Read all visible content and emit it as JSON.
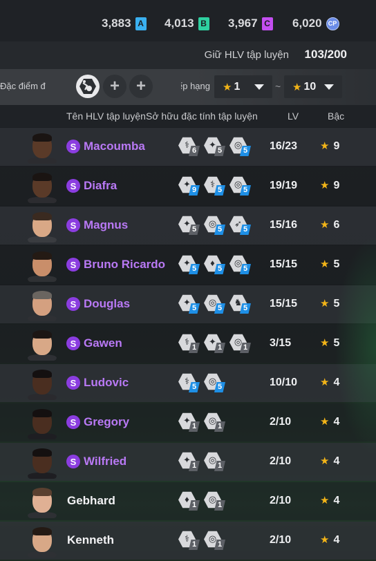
{
  "currencies": [
    {
      "value": "3,883",
      "badge": "A",
      "color": "#3ab0f0"
    },
    {
      "value": "4,013",
      "badge": "B",
      "color": "#2ed0a0"
    },
    {
      "value": "3,967",
      "badge": "C",
      "color": "#c34ef0"
    },
    {
      "value": "6,020",
      "badge": "CP",
      "color": "#6a8ce8"
    }
  ],
  "hold": {
    "label": "Giữ HLV tập luyện",
    "count": "103/200"
  },
  "filters": {
    "trait_label": "Đặc điểm đ",
    "rank_label": "Xếp hạng",
    "min_grade": "1",
    "max_grade": "10",
    "separator": "~",
    "add_symbol": "+"
  },
  "columns": {
    "name": "Tên HLV tập luyện",
    "traits": "Sở hữu đặc tính tập luyện",
    "level": "LV",
    "grade": "Bậc"
  },
  "special_badge": "S",
  "star_glyph": "★",
  "trainers": [
    {
      "name": "Macoumba",
      "special": true,
      "lv": "16/23",
      "grade": "9",
      "skin": "#5a3a28",
      "hair": "#1a1412",
      "shirt": "#2c2c30",
      "traits": [
        {
          "icon": "shield-icon",
          "glyph": "⚕",
          "level": "6",
          "tier": "gray"
        },
        {
          "icon": "kick-icon",
          "glyph": "✦",
          "level": "5",
          "tier": "gray"
        },
        {
          "icon": "dribble-icon",
          "glyph": "◎",
          "level": "5",
          "tier": "blue"
        }
      ]
    },
    {
      "name": "Diafra",
      "special": true,
      "lv": "19/19",
      "grade": "9",
      "skin": "#5a3a28",
      "hair": "#1a1412",
      "shirt": "#2c2c30",
      "traits": [
        {
          "icon": "kick-icon",
          "glyph": "✦",
          "level": "9",
          "tier": "blue"
        },
        {
          "icon": "shield-icon",
          "glyph": "⚕",
          "level": "5",
          "tier": "blue"
        },
        {
          "icon": "dribble-icon",
          "glyph": "◎",
          "level": "5",
          "tier": "blue"
        }
      ]
    },
    {
      "name": "Magnus",
      "special": true,
      "lv": "15/16",
      "grade": "6",
      "skin": "#d9a886",
      "hair": "#3a2a20",
      "shirt": "#3a3c40",
      "traits": [
        {
          "icon": "kick-icon",
          "glyph": "✦",
          "level": "5",
          "tier": "gray"
        },
        {
          "icon": "dribble-icon",
          "glyph": "◎",
          "level": "5",
          "tier": "blue"
        },
        {
          "icon": "tackle-icon",
          "glyph": "➶",
          "level": "5",
          "tier": "blue"
        }
      ]
    },
    {
      "name": "Bruno Ricardo",
      "special": true,
      "lv": "15/15",
      "grade": "5",
      "skin": "#c98e6a",
      "hair": "#241a14",
      "shirt": "#2f3134",
      "traits": [
        {
          "icon": "kick-icon",
          "glyph": "✦",
          "level": "5",
          "tier": "blue"
        },
        {
          "icon": "bottle-icon",
          "glyph": "♦",
          "level": "5",
          "tier": "blue"
        },
        {
          "icon": "dribble-icon",
          "glyph": "◎",
          "level": "5",
          "tier": "blue"
        }
      ]
    },
    {
      "name": "Douglas",
      "special": true,
      "lv": "15/15",
      "grade": "5",
      "skin": "#d4a080",
      "hair": "#6a6560",
      "shirt": "#2e3034",
      "traits": [
        {
          "icon": "kick-icon",
          "glyph": "✦",
          "level": "5",
          "tier": "blue"
        },
        {
          "icon": "dribble-icon",
          "glyph": "◎",
          "level": "5",
          "tier": "blue"
        },
        {
          "icon": "keeper-icon",
          "glyph": "♞",
          "level": "5",
          "tier": "blue"
        }
      ]
    },
    {
      "name": "Gawen",
      "special": true,
      "lv": "3/15",
      "grade": "5",
      "skin": "#d8a887",
      "hair": "#1c1614",
      "shirt": "#2e3034",
      "traits": [
        {
          "icon": "shield-icon",
          "glyph": "⚕",
          "level": "1",
          "tier": "gray"
        },
        {
          "icon": "kick-icon",
          "glyph": "✦",
          "level": "1",
          "tier": "gray"
        },
        {
          "icon": "dribble-icon",
          "glyph": "◎",
          "level": "1",
          "tier": "gray"
        }
      ]
    },
    {
      "name": "Ludovic",
      "special": true,
      "lv": "10/10",
      "grade": "4",
      "skin": "#4a2e20",
      "hair": "#141010",
      "shirt": "#2a2a2e",
      "traits": [
        {
          "icon": "shield-icon",
          "glyph": "⚕",
          "level": "5",
          "tier": "blue"
        },
        {
          "icon": "dribble-icon",
          "glyph": "◎",
          "level": "5",
          "tier": "blue"
        }
      ]
    },
    {
      "name": "Gregory",
      "special": true,
      "lv": "2/10",
      "grade": "4",
      "skin": "#4a2e20",
      "hair": "#141010",
      "shirt": "#1e1e22",
      "traits": [
        {
          "icon": "kick-icon",
          "glyph": "✦",
          "level": "1",
          "tier": "gray"
        },
        {
          "icon": "dribble-icon",
          "glyph": "◎",
          "level": "1",
          "tier": "gray"
        }
      ]
    },
    {
      "name": "Wilfried",
      "special": true,
      "lv": "2/10",
      "grade": "4",
      "skin": "#4a2e20",
      "hair": "#141010",
      "shirt": "#1e1e22",
      "traits": [
        {
          "icon": "kick-icon",
          "glyph": "✦",
          "level": "1",
          "tier": "gray"
        },
        {
          "icon": "dribble-icon",
          "glyph": "◎",
          "level": "1",
          "tier": "gray"
        }
      ]
    },
    {
      "name": "Gebhard",
      "special": false,
      "lv": "2/10",
      "grade": "4",
      "skin": "#e0b094",
      "hair": "#5a4030",
      "shirt": "#2e3034",
      "traits": [
        {
          "icon": "bottle-icon",
          "glyph": "♦",
          "level": "1",
          "tier": "gray"
        },
        {
          "icon": "dribble-icon",
          "glyph": "◎",
          "level": "1",
          "tier": "gray"
        }
      ]
    },
    {
      "name": "Kenneth",
      "special": false,
      "lv": "2/10",
      "grade": "4",
      "skin": "#d8a887",
      "hair": "#241a14",
      "shirt": "#2e3034",
      "traits": [
        {
          "icon": "shield-icon",
          "glyph": "⚕",
          "level": "1",
          "tier": "gray"
        },
        {
          "icon": "dribble-icon",
          "glyph": "◎",
          "level": "1",
          "tier": "gray"
        }
      ]
    }
  ]
}
